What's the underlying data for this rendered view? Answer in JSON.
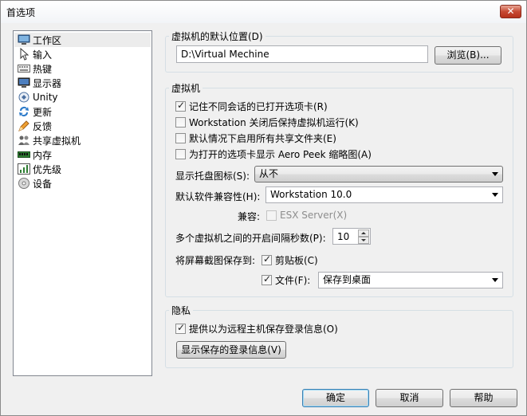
{
  "window": {
    "title": "首选项",
    "close_glyph": "✕"
  },
  "sidebar": {
    "items": [
      {
        "label": "工作区",
        "icon": "workspace-icon"
      },
      {
        "label": "输入",
        "icon": "input-icon"
      },
      {
        "label": "热键",
        "icon": "hotkey-icon"
      },
      {
        "label": "显示器",
        "icon": "display-icon"
      },
      {
        "label": "Unity",
        "icon": "unity-icon"
      },
      {
        "label": "更新",
        "icon": "update-icon"
      },
      {
        "label": "反馈",
        "icon": "feedback-icon"
      },
      {
        "label": "共享虚拟机",
        "icon": "shared-vm-icon"
      },
      {
        "label": "内存",
        "icon": "memory-icon"
      },
      {
        "label": "优先级",
        "icon": "priority-icon"
      },
      {
        "label": "设备",
        "icon": "device-icon"
      }
    ]
  },
  "vm_location": {
    "title": "虚拟机的默认位置(D)",
    "path_value": "D:\\Virtual Mechine",
    "browse_label": "浏览(B)..."
  },
  "vm": {
    "title": "虚拟机",
    "checks": [
      {
        "label": "记住不同会话的已打开选项卡(R)",
        "checked": true
      },
      {
        "label": "Workstation 关闭后保持虚拟机运行(K)",
        "checked": false
      },
      {
        "label": "默认情况下启用所有共享文件夹(E)",
        "checked": false
      },
      {
        "label": "为打开的选项卡显示 Aero Peek 缩略图(A)",
        "checked": false
      }
    ],
    "tray_label": "显示托盘图标(S):",
    "tray_value": "从不",
    "compat_label": "默认软件兼容性(H):",
    "compat_value": "Workstation 10.0",
    "compatible_label": "兼容:",
    "esx_label": "ESX Server(X)",
    "interval_label": "多个虚拟机之间的开启间隔秒数(P):",
    "interval_value": "10",
    "screenshot_label": "将屏幕截图保存到:",
    "clipboard_label": "剪贴板(C)",
    "file_label": "文件(F):",
    "file_value": "保存到桌面"
  },
  "privacy": {
    "title": "隐私",
    "remote_label": "提供以为远程主机保存登录信息(O)",
    "show_saved_label": "显示保存的登录信息(V)"
  },
  "footer": {
    "ok": "确定",
    "cancel": "取消",
    "help": "帮助"
  },
  "colors": {
    "accent": "#3c7fb1",
    "close": "#c74a33",
    "selected_bg": "#ececec"
  }
}
